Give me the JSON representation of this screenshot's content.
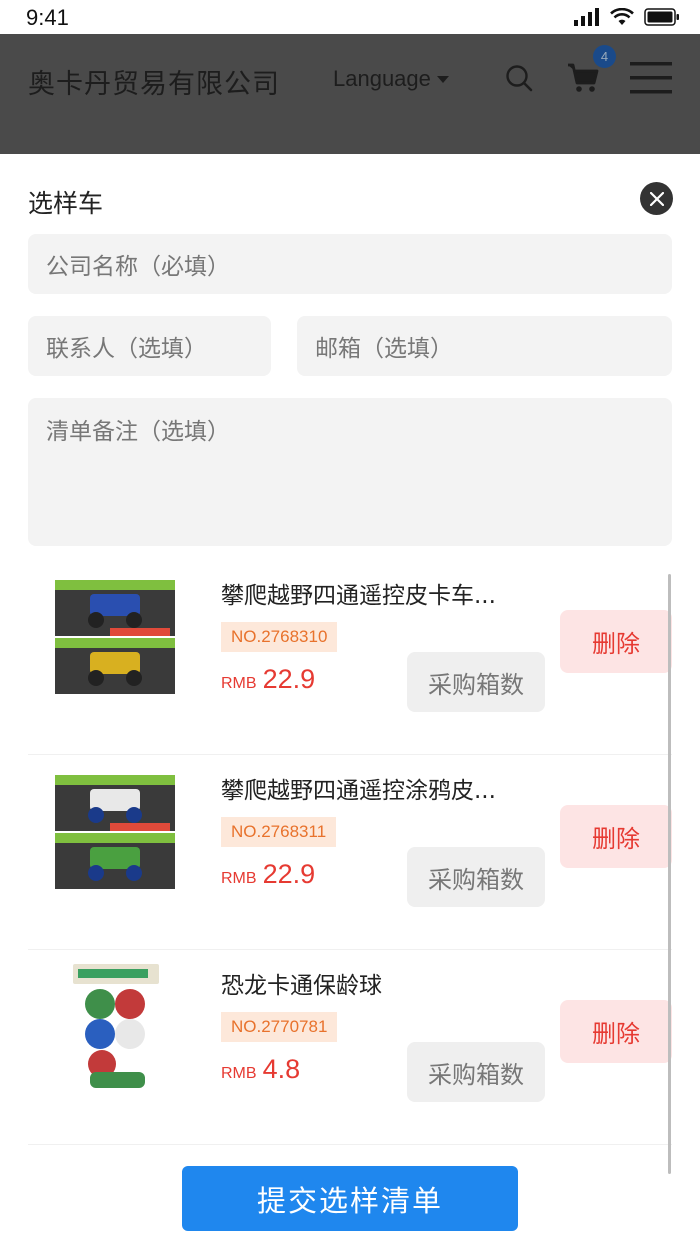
{
  "status_bar": {
    "time": "9:41"
  },
  "header": {
    "company_name": "奥卡丹贸易有限公司",
    "language_label": "Language",
    "cart_count": "4"
  },
  "sheet": {
    "title": "选样车",
    "form": {
      "company_placeholder": "公司名称（必填）",
      "contact_placeholder": "联系人（选填）",
      "email_placeholder": "邮箱（选填）",
      "note_placeholder": "清单备注（选填）"
    },
    "items": [
      {
        "name": "攀爬越野四通遥控皮卡车...",
        "number": "NO.2768310",
        "currency": "RMB",
        "price": "22.9",
        "qty_label": "采购箱数",
        "delete_label": "删除"
      },
      {
        "name": "攀爬越野四通遥控涂鸦皮...",
        "number": "NO.2768311",
        "currency": "RMB",
        "price": "22.9",
        "qty_label": "采购箱数",
        "delete_label": "删除"
      },
      {
        "name": "恐龙卡通保龄球",
        "number": "NO.2770781",
        "currency": "RMB",
        "price": "4.8",
        "qty_label": "采购箱数",
        "delete_label": "删除"
      }
    ],
    "submit_label": "提交选样清单"
  },
  "colors": {
    "accent_blue": "#1f87ee",
    "price_red": "#e63a32",
    "tag_orange": "#e8722c",
    "overlay_header": "#4a4a4a"
  }
}
